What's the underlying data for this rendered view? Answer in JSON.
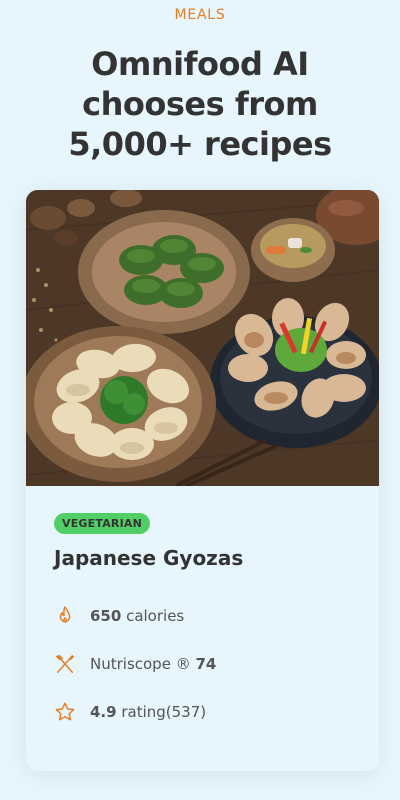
{
  "section": {
    "subheading": "MEALS",
    "heading": "Omnifood AI chooses from 5,000+ recipes"
  },
  "meal": {
    "image_alt": "Japanese Gyozas",
    "tag": "VEGETARIAN",
    "title": "Japanese Gyozas",
    "attributes": [
      {
        "icon": "flame-icon",
        "value": "650",
        "label": " calories"
      },
      {
        "icon": "utensils-icon",
        "label": "Nutriscope ® ",
        "value": "74"
      },
      {
        "icon": "star-icon",
        "value": "4.9",
        "label": " rating(537)"
      }
    ]
  },
  "colors": {
    "accent": "#e67e22",
    "background": "#e7f5fd",
    "tag_vegetarian": "#51cf66",
    "text": "#333333"
  }
}
